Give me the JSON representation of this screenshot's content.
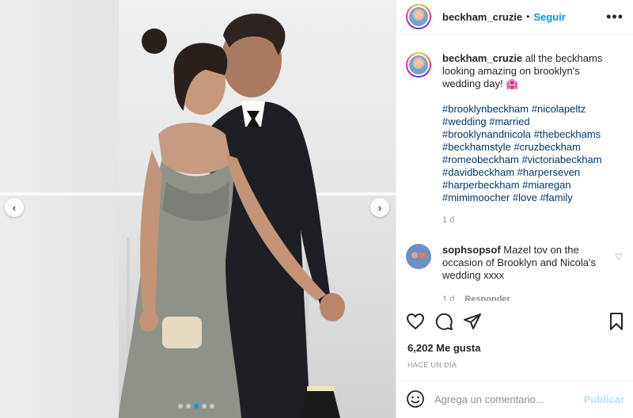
{
  "post": {
    "username": "beckham_cruzie",
    "follow_label": "Seguir",
    "bullet": "•",
    "more_label": "•••"
  },
  "caption": {
    "username": "beckham_cruzie",
    "text": "all the beckhams looking amazing on brooklyn's wedding day! 🏩",
    "hashtags": "#brooklynbeckham #nicolapeltz #wedding #married #brooklynandnicola #thebeckhams #beckhamstyle #cruzbeckham #romeobeckham #victoriabeckham #davidbeckham #harperseven #harperbeckham #miaregan #mimimoocher #love #family",
    "time": "1 d"
  },
  "comment": {
    "username": "sophsopsof",
    "text": "Mazel tov on the occasion of Brooklyn and Nicola's wedding xxxx",
    "time": "1 d",
    "reply_label": "Responder"
  },
  "stats": {
    "likes": "6,202 Me gusta",
    "ago": "HACE UN DÍA"
  },
  "add_comment": {
    "placeholder": "Agrega un comentario...",
    "publish_label": "Publicar"
  },
  "carousel": {
    "prev": "‹",
    "next": "›",
    "count": 5,
    "active_index": 2
  },
  "colors": {
    "accent": "#0095f6",
    "hashtag": "#00376b",
    "muted": "#8e8e8e",
    "publish_disabled": "#b2dffc"
  },
  "icons": [
    "heart-icon",
    "comment-icon",
    "share-icon",
    "bookmark-icon",
    "emoji-icon",
    "more-options-icon"
  ]
}
